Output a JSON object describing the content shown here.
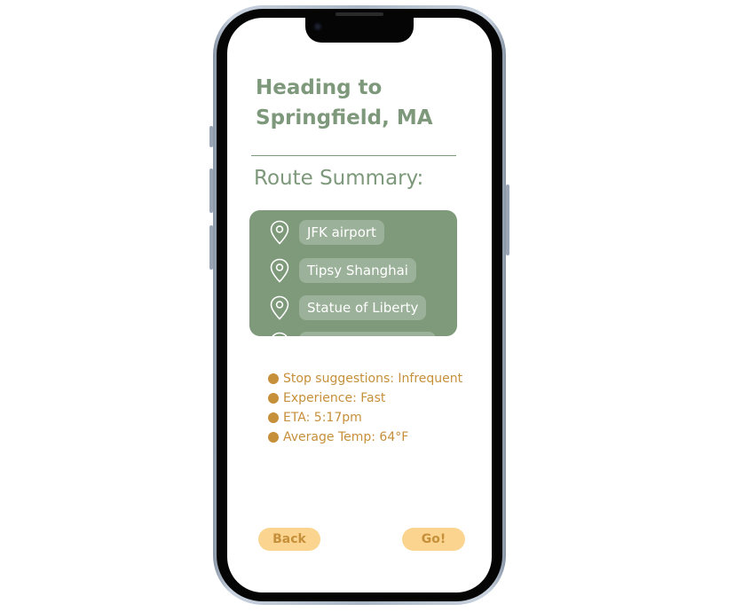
{
  "header": {
    "title": "Heading to Springfield, MA",
    "subtitle": "Route Summary:"
  },
  "route": {
    "stops": [
      {
        "label": "JFK  airport",
        "icon": "map-pin-icon"
      },
      {
        "label": "Tipsy Shanghai",
        "icon": "map-pin-icon"
      },
      {
        "label": "Statue of Liberty",
        "icon": "map-pin-icon"
      }
    ]
  },
  "details": {
    "items": [
      "Stop suggestions: Infrequent",
      "Experience: Fast",
      "ETA: 5:17pm",
      "Average Temp: 64°F"
    ]
  },
  "actions": {
    "back_label": "Back",
    "go_label": "Go!"
  },
  "colors": {
    "primary_green": "#7d987a",
    "card_green": "#7e9a7b",
    "chip_green": "#9bb199",
    "accent_orange": "#c68f3a",
    "button_yellow": "#fbd590"
  }
}
